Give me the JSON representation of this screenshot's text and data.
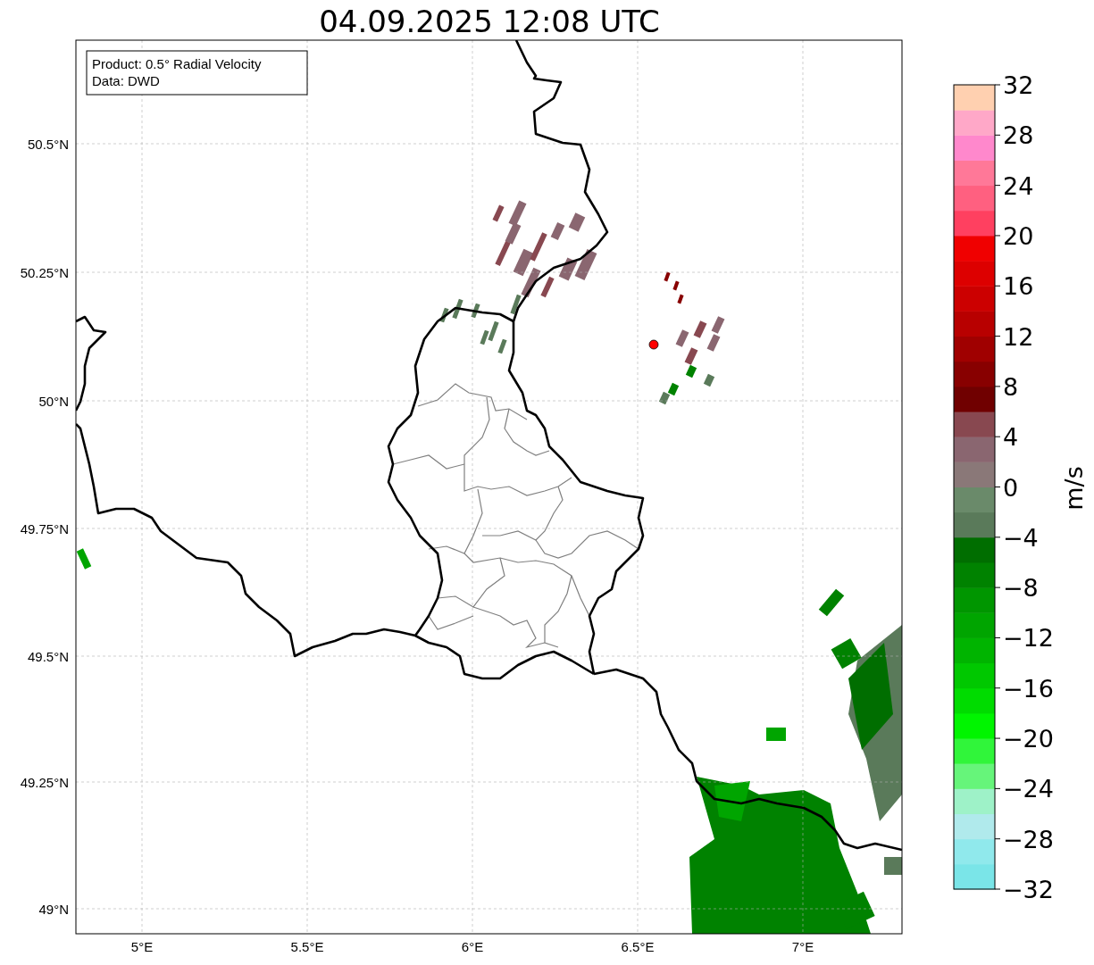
{
  "title": "04.09.2025 12:08 UTC",
  "legend": [
    "Product: 0.5° Radial Velocity",
    "Data: DWD"
  ],
  "lat_ticks": [
    "50.5°N",
    "50.25°N",
    "50°N",
    "49.75°N",
    "49.5°N",
    "49.25°N",
    "49°N"
  ],
  "lon_ticks": [
    "5°E",
    "5.5°E",
    "6°E",
    "6.5°E",
    "7°E"
  ],
  "colorbar": {
    "label": "m/s",
    "ticks": [
      "32",
      "28",
      "24",
      "20",
      "16",
      "12",
      "8",
      "4",
      "0",
      "−4",
      "−8",
      "−12",
      "−16",
      "−20",
      "−24",
      "−28",
      "−32"
    ],
    "segments": [
      {
        "color": "#7ae5e8"
      },
      {
        "color": "#90e9ec"
      },
      {
        "color": "#b0eaec"
      },
      {
        "color": "#9ef2c8"
      },
      {
        "color": "#66f57a"
      },
      {
        "color": "#30f53a"
      },
      {
        "color": "#00f500"
      },
      {
        "color": "#00dc00"
      },
      {
        "color": "#00c800"
      },
      {
        "color": "#00b400"
      },
      {
        "color": "#00a500"
      },
      {
        "color": "#009600"
      },
      {
        "color": "#008200"
      },
      {
        "color": "#006e00"
      },
      {
        "color": "#5a7a5a"
      },
      {
        "color": "#6a8a6a"
      },
      {
        "color": "#8a7878"
      },
      {
        "color": "#8a6670"
      },
      {
        "color": "#884850"
      },
      {
        "color": "#700000"
      },
      {
        "color": "#880000"
      },
      {
        "color": "#a00000"
      },
      {
        "color": "#b80000"
      },
      {
        "color": "#cc0000"
      },
      {
        "color": "#dd0000"
      },
      {
        "color": "#f00000"
      },
      {
        "color": "#ff4060"
      },
      {
        "color": "#ff6080"
      },
      {
        "color": "#ff7898"
      },
      {
        "color": "#ff88cc"
      },
      {
        "color": "#ffa8c8"
      },
      {
        "color": "#ffd0b0"
      }
    ]
  }
}
